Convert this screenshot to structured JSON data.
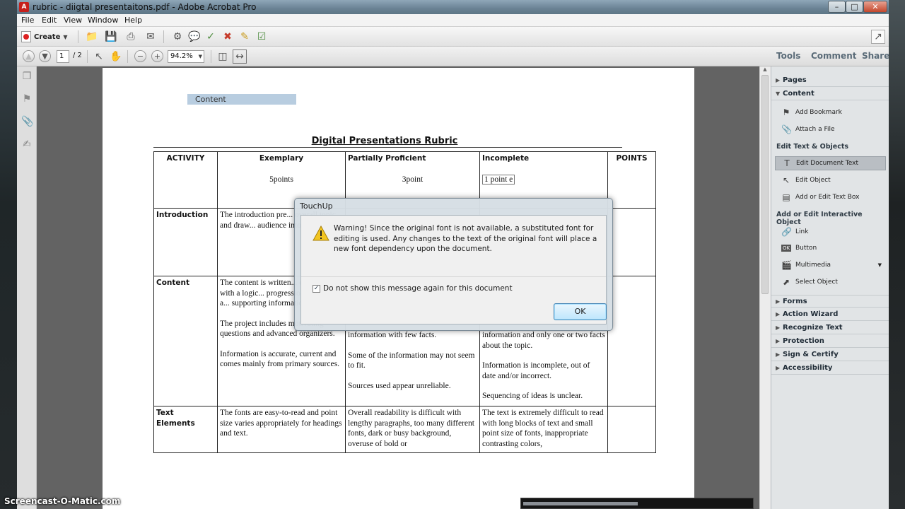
{
  "window": {
    "title": "rubric - diigtal presentaitons.pdf - Adobe Acrobat Pro",
    "app_icon": "acrobat-icon"
  },
  "menu": [
    "File",
    "Edit",
    "View",
    "Window",
    "Help"
  ],
  "toolbar": {
    "create_label": "Create"
  },
  "nav_toolbar": {
    "page_current": "1",
    "page_total": "/ 2",
    "zoom": "94.2%"
  },
  "pane_tabs": {
    "tools": "Tools",
    "comment": "Comment",
    "share": "Share"
  },
  "document": {
    "content_tag": "Content",
    "title": "Digital Presentations Rubric",
    "headers": [
      "ACTIVITY",
      "Exemplary",
      "Partially Proficient",
      "Incomplete",
      "POINTS"
    ],
    "points": [
      "5points",
      "3point",
      "1 point e"
    ],
    "rows": [
      {
        "activity": "Introduction",
        "exemplary": [
          "The introduction pre... overall topic and draw... audience into the pre..."
        ],
        "partial": [
          ""
        ],
        "incomplete": [
          ""
        ]
      },
      {
        "activity": "Content",
        "exemplary": [
          "The content is written... concisely with a logic... progression of ideas a... supporting informatio...",
          "The project includes motivating questions and advanced organizers.",
          "Information is accurate, current and comes mainly from  primary sources."
        ],
        "partial": [
          "information with few facts.",
          "Some of the information may not seem to fit.",
          "Sources used appear unreliable."
        ],
        "incomplete": [
          "information and only one or two facts about the topic.",
          "Information is incomplete, out of date and/or incorrect.",
          "Sequencing of ideas is unclear."
        ]
      },
      {
        "activity": "Text Elements",
        "exemplary": [
          "The fonts are easy-to-read and point size varies appropriately for headings and text."
        ],
        "partial": [
          "Overall readability is difficult with lengthy paragraphs, too many different fonts, dark or busy background, overuse of bold or"
        ],
        "incomplete": [
          "The text is extremely difficult to read with long blocks of text and small point size of fonts, inappropriate contrasting colors,"
        ]
      }
    ]
  },
  "right_pane": {
    "sections_top": [
      "Pages",
      "Content"
    ],
    "content_items": [
      "Add Bookmark",
      "Attach a File"
    ],
    "edit_group_label": "Edit Text & Objects",
    "edit_items": [
      "Edit Document Text",
      "Edit Object",
      "Add or Edit Text Box"
    ],
    "interactive_group_label": "Add or Edit Interactive Object",
    "interactive_items": [
      "Link",
      "Button",
      "Multimedia",
      "Select Object"
    ],
    "sections_bottom": [
      "Forms",
      "Action Wizard",
      "Recognize Text",
      "Protection",
      "Sign & Certify",
      "Accessibility"
    ]
  },
  "dialog": {
    "title": "TouchUp",
    "message": "Warning! Since the original font is not available, a substituted font for editing is used.  Any changes to the text of the original font will place a new font dependency upon the document.",
    "checkbox_label": "Do not show this message again for this document",
    "checkbox_checked": true,
    "ok_label": "OK"
  },
  "watermark": "Screencast-O-Matic.com",
  "recording_progress": 0.5
}
